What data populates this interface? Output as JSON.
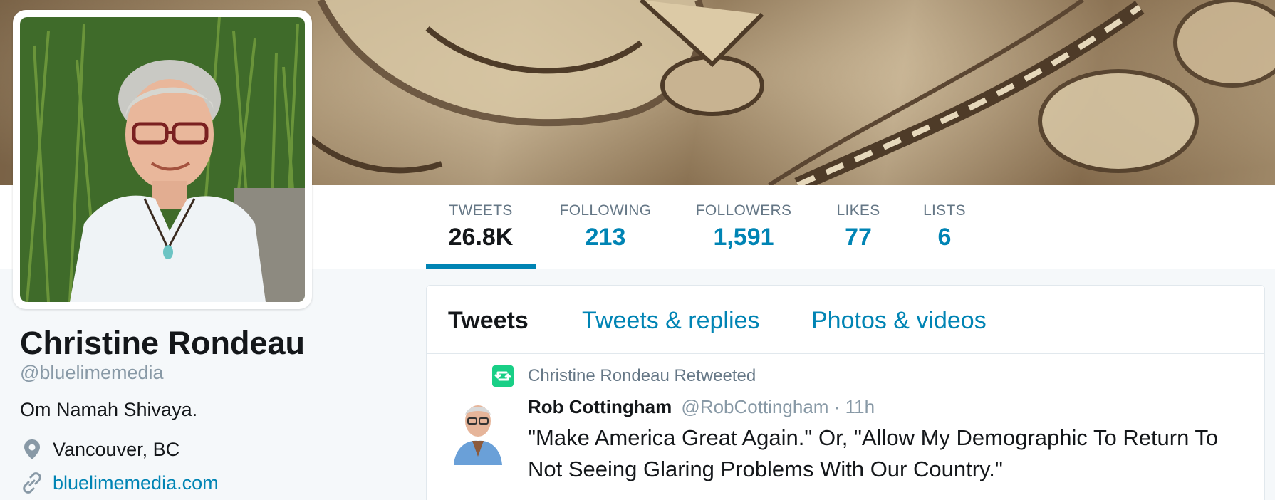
{
  "profile": {
    "name": "Christine Rondeau",
    "handle": "@bluelimemedia",
    "bio": "Om Namah Shivaya.",
    "location": "Vancouver, BC",
    "website": "bluelimemedia.com"
  },
  "stats": [
    {
      "label": "TWEETS",
      "value": "26.8K",
      "active": true
    },
    {
      "label": "FOLLOWING",
      "value": "213",
      "active": false
    },
    {
      "label": "FOLLOWERS",
      "value": "1,591",
      "active": false
    },
    {
      "label": "LIKES",
      "value": "77",
      "active": false
    },
    {
      "label": "LISTS",
      "value": "6",
      "active": false
    }
  ],
  "tabs": [
    {
      "label": "Tweets",
      "active": true
    },
    {
      "label": "Tweets & replies",
      "active": false
    },
    {
      "label": "Photos & videos",
      "active": false
    }
  ],
  "tweet": {
    "retweet_label": "Christine Rondeau Retweeted",
    "author": "Rob Cottingham",
    "handle": "@RobCottingham",
    "time": "· 11h",
    "text": "\"Make America Great Again.\" Or, \"Allow My Demographic To Return To Not Seeing Glaring Problems With Our Country.\""
  },
  "icons": {
    "location": "map-pin-icon",
    "website": "link-icon",
    "retweet": "retweet-icon"
  },
  "colors": {
    "link": "#0084b4",
    "text": "#14171a",
    "muted": "#657786",
    "retweet": "#19cf86",
    "background": "#f5f8fa"
  }
}
